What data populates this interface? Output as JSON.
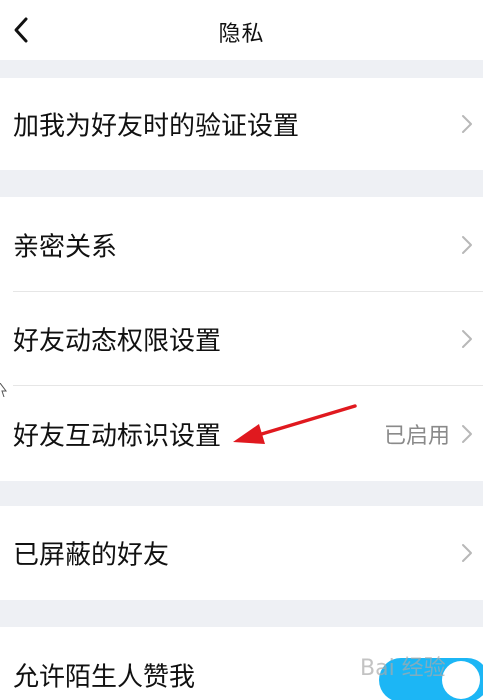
{
  "header": {
    "title": "隐私",
    "back_icon": "chevron-left-icon"
  },
  "groups": [
    {
      "items": [
        {
          "label": "加我为好友时的验证设置",
          "value": "",
          "icon": "chevron-right-icon"
        }
      ]
    },
    {
      "items": [
        {
          "label": "亲密关系",
          "value": "",
          "icon": "chevron-right-icon"
        },
        {
          "label": "好友动态权限设置",
          "value": "",
          "icon": "chevron-right-icon"
        },
        {
          "label": "好友互动标识设置",
          "value": "已启用",
          "icon": "chevron-right-icon"
        }
      ]
    },
    {
      "items": [
        {
          "label": "已屏蔽的好友",
          "value": "",
          "icon": "chevron-right-icon"
        }
      ]
    },
    {
      "items": [
        {
          "label": "允许陌生人赞我",
          "toggle_on": true
        }
      ]
    }
  ],
  "watermark": "Bai 经验",
  "colors": {
    "background": "#eef0f4",
    "row": "#ffffff",
    "text": "#111111",
    "secondary_text": "#8a8a8a",
    "chevron": "#b8b8b8",
    "toggle_on": "#1cb6f5",
    "annotation_arrow": "#e0191f"
  }
}
